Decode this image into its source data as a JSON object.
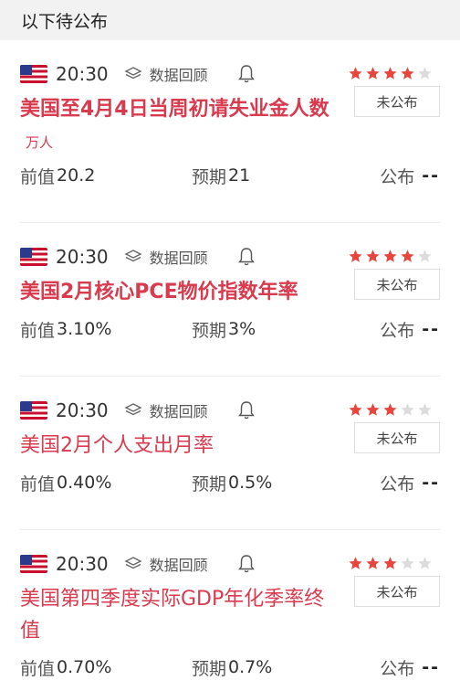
{
  "header": {
    "title": "以下待公布"
  },
  "common": {
    "review_label": "数据回顾",
    "pending_label": "未公布",
    "prev_label": "前值",
    "expected_label": "预期",
    "publish_label": "公布",
    "publish_value": "--",
    "star_color": "#e8453c",
    "star_empty_color": "#dcdcdc",
    "title_color": "#d93a4d"
  },
  "items": [
    {
      "time": "20:30",
      "importance": 4,
      "title": "美国至4月4日当周初请失业金人数",
      "unit": "万人",
      "prev": "20.2",
      "expected": "21"
    },
    {
      "time": "20:30",
      "importance": 4,
      "title": "美国2月核心PCE物价指数年率",
      "unit": "",
      "prev": "3.10%",
      "expected": "3%"
    },
    {
      "time": "20:30",
      "importance": 3,
      "title": "美国2月个人支出月率",
      "unit": "",
      "prev": "0.40%",
      "expected": "0.5%"
    },
    {
      "time": "20:30",
      "importance": 3,
      "title": "美国第四季度实际GDP年化季率终值",
      "unit": "",
      "prev": "0.70%",
      "expected": "0.7%"
    }
  ]
}
